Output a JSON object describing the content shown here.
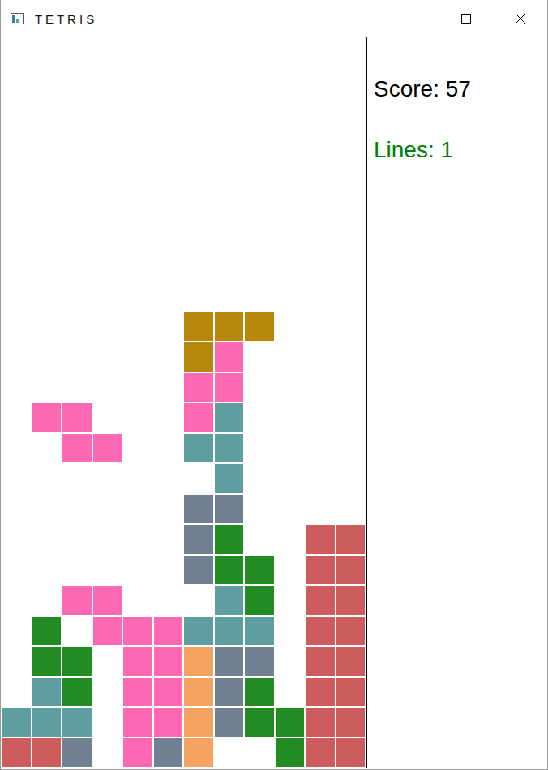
{
  "window": {
    "title": "T E T R I S"
  },
  "score": {
    "label": "Score: 57"
  },
  "lines": {
    "label": "Lines: 1"
  },
  "board": {
    "columns": 12,
    "rows": [
      [
        null,
        null,
        null,
        null,
        null,
        null,
        null,
        null,
        null,
        null,
        null,
        null
      ],
      [
        null,
        null,
        null,
        null,
        null,
        null,
        null,
        null,
        null,
        null,
        null,
        null
      ],
      [
        null,
        null,
        null,
        null,
        null,
        null,
        null,
        null,
        null,
        null,
        null,
        null
      ],
      [
        null,
        null,
        null,
        null,
        null,
        null,
        null,
        null,
        null,
        null,
        null,
        null
      ],
      [
        null,
        null,
        null,
        null,
        null,
        null,
        null,
        null,
        null,
        null,
        null,
        null
      ],
      [
        null,
        null,
        null,
        null,
        null,
        null,
        null,
        null,
        null,
        null,
        null,
        null
      ],
      [
        null,
        null,
        null,
        null,
        null,
        null,
        null,
        null,
        null,
        null,
        null,
        null
      ],
      [
        null,
        null,
        null,
        null,
        null,
        null,
        null,
        null,
        null,
        null,
        null,
        null
      ],
      [
        null,
        null,
        null,
        null,
        null,
        null,
        null,
        null,
        null,
        null,
        null,
        null
      ],
      [
        null,
        null,
        null,
        null,
        null,
        null,
        "#b8860b",
        "#b8860b",
        "#b8860b",
        null,
        null,
        null
      ],
      [
        null,
        null,
        null,
        null,
        null,
        null,
        "#b8860b",
        "#ff69b4",
        null,
        null,
        null,
        null
      ],
      [
        null,
        null,
        null,
        null,
        null,
        null,
        "#ff69b4",
        "#ff69b4",
        null,
        null,
        null,
        null
      ],
      [
        null,
        "#ff69b4",
        "#ff69b4",
        null,
        null,
        null,
        "#ff69b4",
        "#5f9ea0",
        null,
        null,
        null,
        null
      ],
      [
        null,
        null,
        "#ff69b4",
        "#ff69b4",
        null,
        null,
        "#5f9ea0",
        "#5f9ea0",
        null,
        null,
        null,
        null
      ],
      [
        null,
        null,
        null,
        null,
        null,
        null,
        null,
        "#5f9ea0",
        null,
        null,
        null,
        null
      ],
      [
        null,
        null,
        null,
        null,
        null,
        null,
        "#708090",
        "#708090",
        null,
        null,
        null,
        null
      ],
      [
        null,
        null,
        null,
        null,
        null,
        null,
        "#708090",
        "#228b22",
        null,
        null,
        "#cd5c5c",
        "#cd5c5c"
      ],
      [
        null,
        null,
        null,
        null,
        null,
        null,
        "#708090",
        "#228b22",
        "#228b22",
        null,
        "#cd5c5c",
        "#cd5c5c"
      ],
      [
        null,
        null,
        "#ff69b4",
        "#ff69b4",
        null,
        null,
        null,
        "#5f9ea0",
        "#228b22",
        null,
        "#cd5c5c",
        "#cd5c5c"
      ],
      [
        null,
        "#228b22",
        null,
        "#ff69b4",
        "#ff69b4",
        "#ff69b4",
        "#5f9ea0",
        "#5f9ea0",
        "#5f9ea0",
        null,
        "#cd5c5c",
        "#cd5c5c"
      ],
      [
        null,
        "#228b22",
        "#228b22",
        null,
        "#ff69b4",
        "#ff69b4",
        "#f4a460",
        "#708090",
        "#708090",
        null,
        "#cd5c5c",
        "#cd5c5c"
      ],
      [
        null,
        "#5f9ea0",
        "#228b22",
        null,
        "#ff69b4",
        "#ff69b4",
        "#f4a460",
        "#708090",
        "#228b22",
        null,
        "#cd5c5c",
        "#cd5c5c"
      ],
      [
        "#5f9ea0",
        "#5f9ea0",
        "#5f9ea0",
        null,
        "#ff69b4",
        "#ff69b4",
        "#f4a460",
        "#708090",
        "#228b22",
        "#228b22",
        "#cd5c5c",
        "#cd5c5c"
      ],
      [
        "#cd5c5c",
        "#cd5c5c",
        "#708090",
        null,
        "#ff69b4",
        "#708090",
        "#f4a460",
        null,
        null,
        "#228b22",
        "#cd5c5c",
        "#cd5c5c"
      ]
    ]
  }
}
